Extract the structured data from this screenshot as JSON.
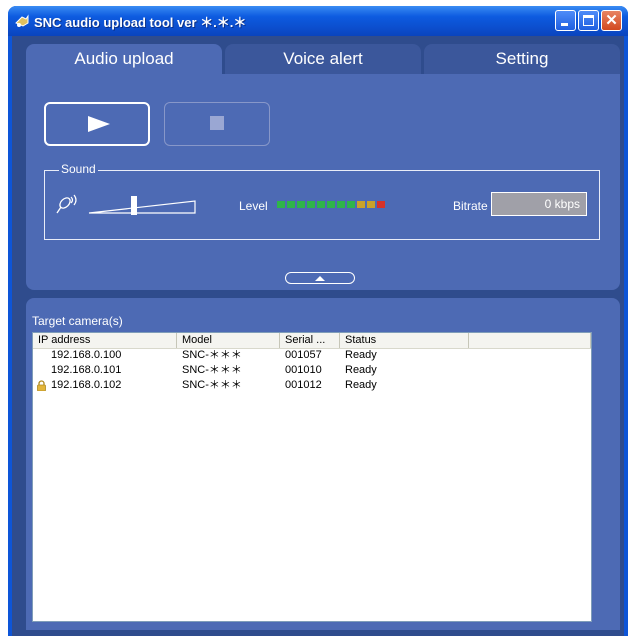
{
  "window": {
    "title": "SNC audio upload tool ver ＊.＊.＊",
    "icon": "app-icon"
  },
  "tabs": [
    {
      "label": "Audio upload",
      "active": true
    },
    {
      "label": "Voice alert",
      "active": false
    },
    {
      "label": "Setting",
      "active": false
    }
  ],
  "controls": {
    "play_icon": "play-icon",
    "stop_icon": "stop-icon",
    "stop_enabled": false
  },
  "sound": {
    "legend": "Sound",
    "level_label": "Level",
    "level_segments": [
      "#2fb54a",
      "#2fb54a",
      "#2fb54a",
      "#2fb54a",
      "#2fb54a",
      "#2fb54a",
      "#2fb54a",
      "#2fb54a",
      "#c9a22a",
      "#c9a22a",
      "#d6322a"
    ],
    "bitrate_label": "Bitrate",
    "bitrate_value": "0 kbps"
  },
  "target": {
    "label": "Target camera(s)",
    "columns": [
      "IP address",
      "Model",
      "Serial ...",
      "Status"
    ],
    "rows": [
      {
        "ip": "192.168.0.100",
        "model": "SNC-＊＊＊",
        "serial": "001057",
        "status": "Ready",
        "locked": false
      },
      {
        "ip": "192.168.0.101",
        "model": "SNC-＊＊＊",
        "serial": "001010",
        "status": "Ready",
        "locked": false
      },
      {
        "ip": "192.168.0.102",
        "model": "SNC-＊＊＊",
        "serial": "001012",
        "status": "Ready",
        "locked": true
      }
    ]
  },
  "colors": {
    "panel": "#4d6ab4",
    "titlebar": "#0d55d8",
    "lock": "#e3b53a"
  }
}
